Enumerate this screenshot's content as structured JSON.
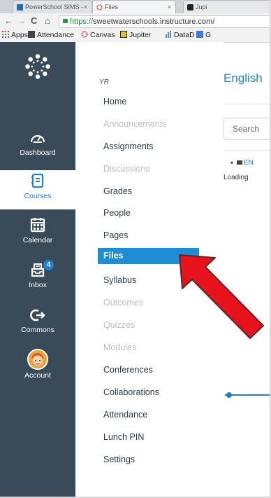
{
  "browser": {
    "tabs": [
      {
        "label": "PowerSchool SIMS -",
        "close": "×"
      },
      {
        "label": "Files",
        "close": "×"
      },
      {
        "label": "Jupi",
        "close": ""
      }
    ],
    "nav": {
      "back": "←",
      "forward": "→",
      "reload": "C",
      "home": "⌂"
    },
    "url": {
      "scheme": "https://",
      "rest": "sweetwaterschools.instructure.com/"
    },
    "bookmarks": [
      {
        "label": "Apps",
        "icon": "apps-grid-icon"
      },
      {
        "label": "Attendance",
        "icon": "attendance-icon"
      },
      {
        "label": "Canvas",
        "icon": "canvas-icon"
      },
      {
        "label": "Jupiter",
        "icon": "jupiter-icon"
      },
      {
        "label": "DataD",
        "icon": "bar-chart-icon"
      },
      {
        "label": "G",
        "icon": "g-icon"
      }
    ]
  },
  "global_nav": {
    "items": [
      {
        "label": "Dashboard",
        "icon": "dashboard-icon"
      },
      {
        "label": "Courses",
        "icon": "courses-icon",
        "active": true
      },
      {
        "label": "Calendar",
        "icon": "calendar-icon"
      },
      {
        "label": "Inbox",
        "icon": "inbox-icon",
        "badge": "4"
      },
      {
        "label": "Commons",
        "icon": "commons-icon"
      },
      {
        "label": "Account",
        "icon": "avatar"
      }
    ]
  },
  "course_nav": {
    "breadcrumb": "YR",
    "items": [
      {
        "label": "Home",
        "disabled": false
      },
      {
        "label": "Announcements",
        "disabled": true
      },
      {
        "label": "Assignments",
        "disabled": false
      },
      {
        "label": "Discussions",
        "disabled": true
      },
      {
        "label": "Grades",
        "disabled": false
      },
      {
        "label": "People",
        "disabled": false
      },
      {
        "label": "Pages",
        "disabled": false
      },
      {
        "label": "Files",
        "disabled": false,
        "selected": true
      },
      {
        "label": "Syllabus",
        "disabled": false
      },
      {
        "label": "Outcomes",
        "disabled": true
      },
      {
        "label": "Quizzes",
        "disabled": true
      },
      {
        "label": "Modules",
        "disabled": true
      },
      {
        "label": "Conferences",
        "disabled": false
      },
      {
        "label": "Collaborations",
        "disabled": false
      },
      {
        "label": "Attendance",
        "disabled": false
      },
      {
        "label": "Lunch PIN",
        "disabled": false
      },
      {
        "label": "Settings",
        "disabled": false
      }
    ]
  },
  "content": {
    "title": "English",
    "search_placeholder": "Search",
    "tree_item": "EN",
    "loading": "Loading"
  },
  "colors": {
    "nav_bg": "#394b58",
    "accent": "#1f81d0",
    "selected_bg": "#1b8ed6",
    "arrow": "#e8121c"
  }
}
